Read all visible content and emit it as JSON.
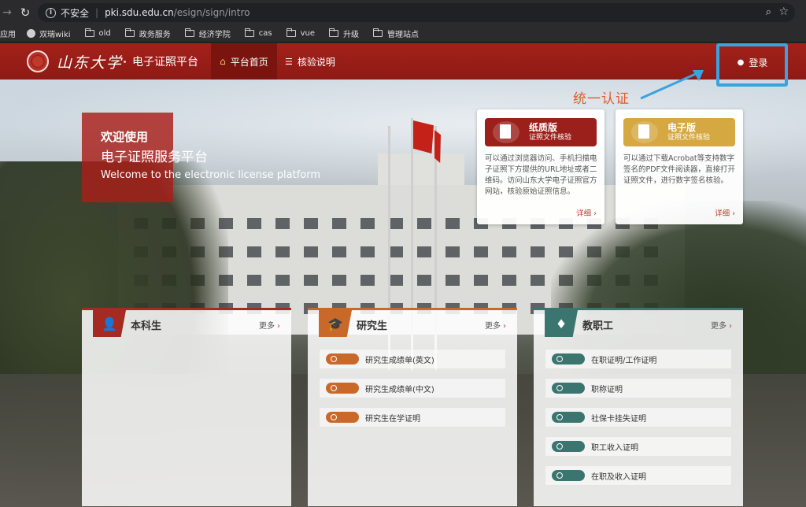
{
  "browser": {
    "insecure_label": "不安全",
    "url_host": "pki.sdu.edu.cn",
    "url_path": "/esign/sign/intro"
  },
  "bookmarks": [
    {
      "label": "应用",
      "icon": "apps-icon"
    },
    {
      "label": "双瑞wiki",
      "icon": "globe-icon"
    },
    {
      "label": "old",
      "icon": "folder-icon"
    },
    {
      "label": "政务服务",
      "icon": "folder-icon"
    },
    {
      "label": "经济学院",
      "icon": "folder-icon"
    },
    {
      "label": "cas",
      "icon": "folder-icon"
    },
    {
      "label": "vue",
      "icon": "folder-icon"
    },
    {
      "label": "升级",
      "icon": "folder-icon"
    },
    {
      "label": "管理站点",
      "icon": "folder-icon"
    }
  ],
  "header": {
    "logo_text": "山东大学",
    "site_title": "电子证照平台",
    "nav": [
      {
        "label": "平台首页",
        "icon": "home-icon",
        "active": true
      },
      {
        "label": "核验说明",
        "icon": "list-icon",
        "active": false
      }
    ],
    "login_label": "登录"
  },
  "annotation": {
    "text": "统一认证",
    "color": "#e45a2a"
  },
  "welcome": {
    "line1": "欢迎使用",
    "line2": "电子证照服务平台",
    "line3": "Welcome to the electronic license platform"
  },
  "cards": {
    "paper": {
      "title": "纸质版",
      "subtitle": "证照文件核验",
      "desc": "可以通过浏览器访问、手机扫描电子证照下方提供的URL地址或者二维码。访问山东大学电子证照官方网站，核验原始证照信息。",
      "more": "详细 ›"
    },
    "electronic": {
      "title": "电子版",
      "subtitle": "证照文件核验",
      "desc": "可以通过下载Acrobat等支持数字签名的PDF文件阅读器，直接打开证照文件，进行数字签名核验。",
      "more": "详细 ›"
    }
  },
  "panels": {
    "undergrad": {
      "title": "本科生",
      "more": "更多",
      "items": []
    },
    "grad": {
      "title": "研究生",
      "more": "更多",
      "items": [
        "研究生成绩单(英文)",
        "研究生成绩单(中文)",
        "研究生在学证明"
      ]
    },
    "staff": {
      "title": "教职工",
      "more": "更多",
      "items": [
        "在职证明/工作证明",
        "职称证明",
        "社保卡挂失证明",
        "职工收入证明",
        "在职及收入证明"
      ]
    }
  },
  "colors": {
    "brand_red": "#9b1f1a",
    "gold": "#d5a841",
    "grad_orange": "#c8692a",
    "staff_teal": "#3a7570",
    "highlight_blue": "#3aa3df"
  }
}
